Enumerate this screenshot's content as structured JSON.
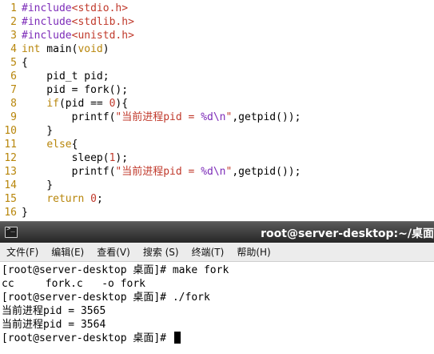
{
  "editor": {
    "lines": [
      {
        "num": "1",
        "parts": [
          {
            "t": "#include",
            "c": "pp"
          },
          {
            "t": "<stdio.h>",
            "c": "hdr"
          }
        ]
      },
      {
        "num": "2",
        "parts": [
          {
            "t": "#include",
            "c": "pp"
          },
          {
            "t": "<stdlib.h>",
            "c": "hdr"
          }
        ]
      },
      {
        "num": "3",
        "parts": [
          {
            "t": "#include",
            "c": "pp"
          },
          {
            "t": "<unistd.h>",
            "c": "hdr"
          }
        ]
      },
      {
        "num": "4",
        "parts": [
          {
            "t": "int",
            "c": "kw"
          },
          {
            "t": " main("
          },
          {
            "t": "void",
            "c": "kw"
          },
          {
            "t": ")"
          }
        ]
      },
      {
        "num": "5",
        "parts": [
          {
            "t": "{"
          }
        ]
      },
      {
        "num": "6",
        "parts": [
          {
            "t": "    pid_t pid;"
          }
        ]
      },
      {
        "num": "7",
        "parts": [
          {
            "t": "    pid = fork();"
          }
        ]
      },
      {
        "num": "8",
        "parts": [
          {
            "t": "    "
          },
          {
            "t": "if",
            "c": "kw"
          },
          {
            "t": "(pid == "
          },
          {
            "t": "0",
            "c": "num"
          },
          {
            "t": "){"
          }
        ]
      },
      {
        "num": "9",
        "parts": [
          {
            "t": "        printf("
          },
          {
            "t": "\"当前进程pid = ",
            "c": "str"
          },
          {
            "t": "%d\\n",
            "c": "fmt"
          },
          {
            "t": "\"",
            "c": "str"
          },
          {
            "t": ",getpid());"
          }
        ]
      },
      {
        "num": "10",
        "parts": [
          {
            "t": "    }"
          }
        ]
      },
      {
        "num": "11",
        "parts": [
          {
            "t": "    "
          },
          {
            "t": "else",
            "c": "kw"
          },
          {
            "t": "{"
          }
        ]
      },
      {
        "num": "12",
        "parts": [
          {
            "t": "        sleep("
          },
          {
            "t": "1",
            "c": "num"
          },
          {
            "t": ");"
          }
        ]
      },
      {
        "num": "13",
        "parts": [
          {
            "t": "        printf("
          },
          {
            "t": "\"当前进程pid = ",
            "c": "str"
          },
          {
            "t": "%d\\n",
            "c": "fmt"
          },
          {
            "t": "\"",
            "c": "str"
          },
          {
            "t": ",getpid());"
          }
        ]
      },
      {
        "num": "14",
        "parts": [
          {
            "t": "    }"
          }
        ]
      },
      {
        "num": "15",
        "parts": [
          {
            "t": "    "
          },
          {
            "t": "return",
            "c": "kw"
          },
          {
            "t": " "
          },
          {
            "t": "0",
            "c": "num"
          },
          {
            "t": ";"
          }
        ]
      },
      {
        "num": "16",
        "parts": [
          {
            "t": "}"
          }
        ]
      }
    ]
  },
  "terminal": {
    "title": "root@server-desktop:~/桌面",
    "icon": "terminal-icon",
    "menu": [
      "文件(F)",
      "编辑(E)",
      "查看(V)",
      "搜索 (S)",
      "终端(T)",
      "帮助(H)"
    ],
    "output": [
      "[root@server-desktop 桌面]# make fork",
      "cc     fork.c   -o fork",
      "[root@server-desktop 桌面]# ./fork",
      "当前进程pid = 3565",
      "当前进程pid = 3564"
    ],
    "prompt": "[root@server-desktop 桌面]# "
  }
}
